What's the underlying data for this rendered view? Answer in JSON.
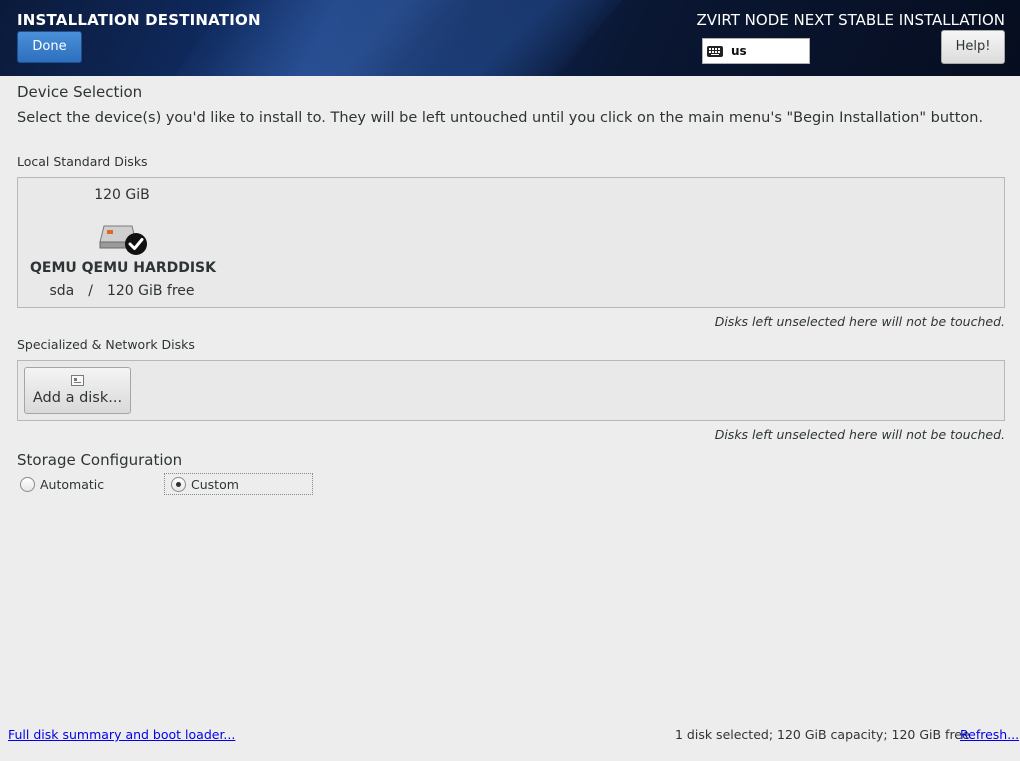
{
  "header": {
    "title": "INSTALLATION DESTINATION",
    "done_label": "Done",
    "product_title": "ZVIRT NODE NEXT STABLE INSTALLATION",
    "keyboard_layout": "us",
    "help_label": "Help!"
  },
  "device_selection": {
    "heading": "Device Selection",
    "instructions": "Select the device(s) you'd like to install to.  They will be left untouched until you click on the main menu's \"Begin Installation\" button."
  },
  "local_disks": {
    "heading": "Local Standard Disks",
    "disks": [
      {
        "size": "120 GiB",
        "name": "QEMU QEMU HARDDISK",
        "device": "sda",
        "separator": "/",
        "free": "120 GiB free",
        "selected": true,
        "icon": "harddisk-checked-icon"
      }
    ],
    "note": "Disks left unselected here will not be touched."
  },
  "network_disks": {
    "heading": "Specialized & Network Disks",
    "add_disk_label": "Add a disk...",
    "note": "Disks left unselected here will not be touched."
  },
  "storage_configuration": {
    "heading": "Storage Configuration",
    "options": [
      {
        "label": "Automatic",
        "selected": false
      },
      {
        "label": "Custom",
        "selected": true
      }
    ]
  },
  "footer": {
    "summary_link": "Full disk summary and boot loader...",
    "status": "1 disk selected; 120 GiB capacity; 120 GiB free",
    "refresh_link": "Refresh..."
  },
  "colors": {
    "header_dark": "#0a1733",
    "done_button": "#2d6fbd",
    "link": "#0000ee",
    "background": "#ededed"
  }
}
